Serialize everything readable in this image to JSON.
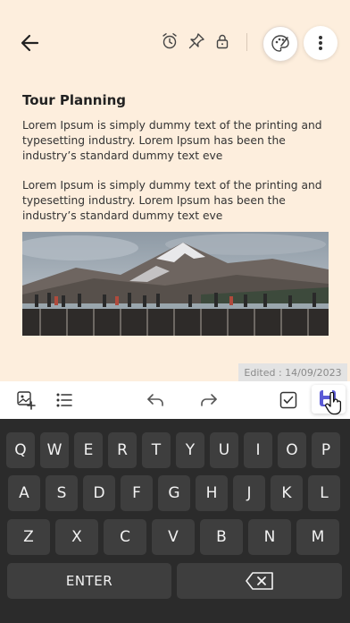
{
  "header": {
    "icons": [
      "back-arrow-icon",
      "alarm-icon",
      "pin-icon",
      "lock-icon",
      "palette-icon",
      "more-vertical-icon"
    ]
  },
  "note": {
    "title": "Tour Planning",
    "paragraphs": [
      "Lorem Ipsum is simply dummy text of the printing and typesetting industry. Lorem Ipsum has been the industry’s standard dummy text eve",
      "Lorem Ipsum is simply dummy text of the printing and typesetting industry. Lorem Ipsum has been the industry’s standard dummy text eve"
    ],
    "image": "mountain-skywalk-photo",
    "edited": "Edited : 14/09/2023"
  },
  "toolbar": {
    "icons": [
      "add-image-icon",
      "bullet-list-icon",
      "undo-icon",
      "redo-icon",
      "checkbox-icon",
      "save-icon"
    ]
  },
  "keyboard": {
    "row1": [
      "Q",
      "W",
      "E",
      "R",
      "T",
      "Y",
      "U",
      "I",
      "O",
      "P"
    ],
    "row2": [
      "A",
      "S",
      "D",
      "F",
      "G",
      "H",
      "J",
      "K",
      "L"
    ],
    "row3": [
      "Z",
      "X",
      "C",
      "V",
      "B",
      "N",
      "M"
    ],
    "enter": "ENTER"
  },
  "colors": {
    "background": "#fdeedd",
    "keyboard": "#2b2b2b",
    "key": "#3e3e3e",
    "accent": "#5b5bd6"
  }
}
